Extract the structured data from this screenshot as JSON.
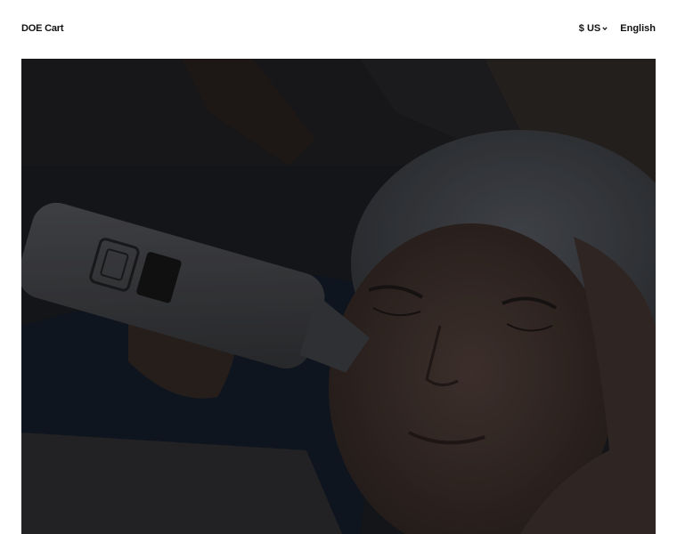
{
  "header": {
    "brand": "DOE Cart",
    "currency": "$ US",
    "language": "English"
  },
  "icons": {
    "currency_dropdown": "chevron-down-icon"
  },
  "colors": {
    "background": "#ffffff",
    "text": "#111111",
    "hero_overlay": "#000000"
  }
}
